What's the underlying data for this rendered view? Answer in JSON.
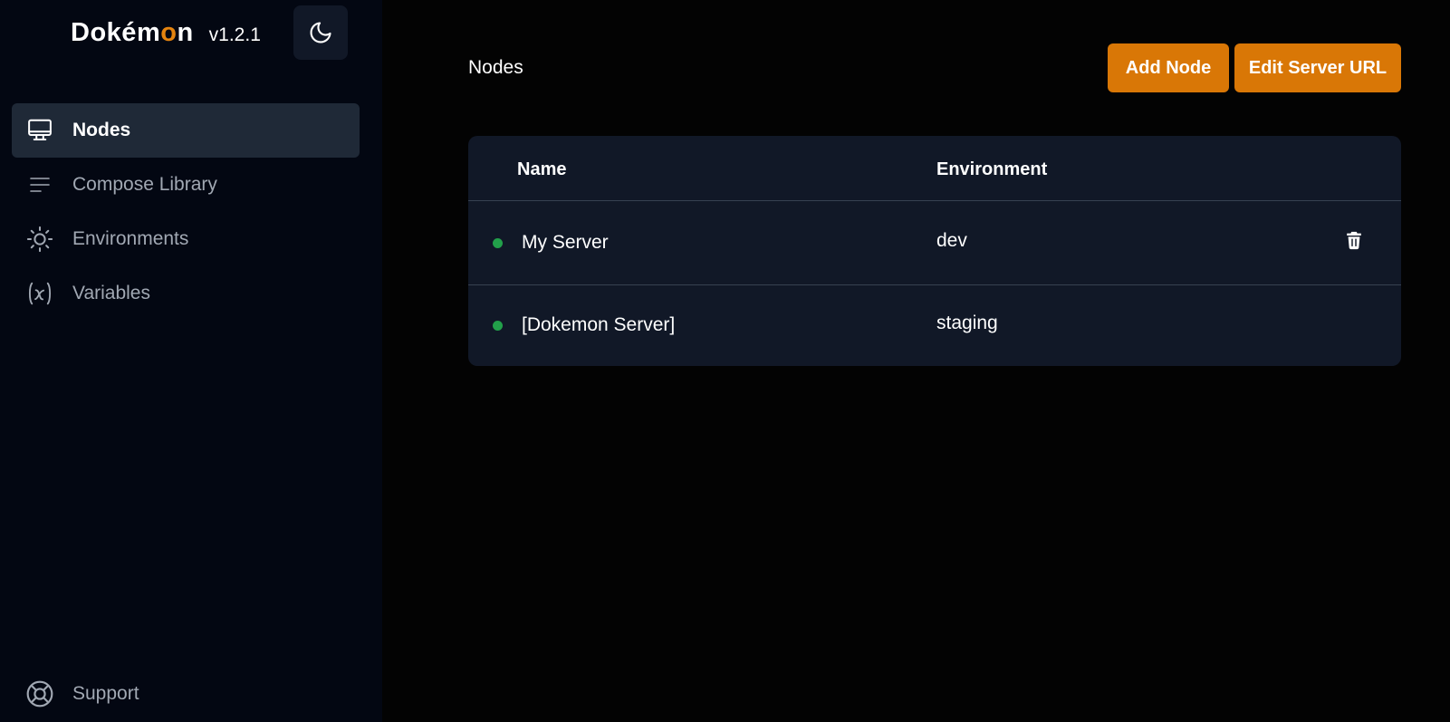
{
  "app": {
    "brand_prefix": "Dok",
    "brand_accent_e": "é",
    "brand_m": "m",
    "brand_o": "o",
    "brand_n": "n",
    "version": "v1.2.1",
    "accent_color": "#d97706"
  },
  "sidebar": {
    "theme_toggle_icon": "moon-icon",
    "items": [
      {
        "label": "Nodes",
        "icon": "monitor-icon",
        "active": true
      },
      {
        "label": "Compose Library",
        "icon": "lines-icon",
        "active": false
      },
      {
        "label": "Environments",
        "icon": "sun-icon",
        "active": false
      },
      {
        "label": "Variables",
        "icon": "variable-x-icon",
        "active": false
      }
    ],
    "support": {
      "label": "Support",
      "icon": "lifebuoy-icon"
    }
  },
  "main": {
    "title": "Nodes",
    "add_node_label": "Add Node",
    "edit_server_url_label": "Edit Server URL",
    "table": {
      "columns": [
        "Name",
        "Environment"
      ],
      "rows": [
        {
          "name": "My Server",
          "environment": "dev",
          "status_color": "#22a04a",
          "deletable": true
        },
        {
          "name": "[Dokemon Server]",
          "environment": "staging",
          "status_color": "#22a04a",
          "deletable": false
        }
      ]
    }
  }
}
